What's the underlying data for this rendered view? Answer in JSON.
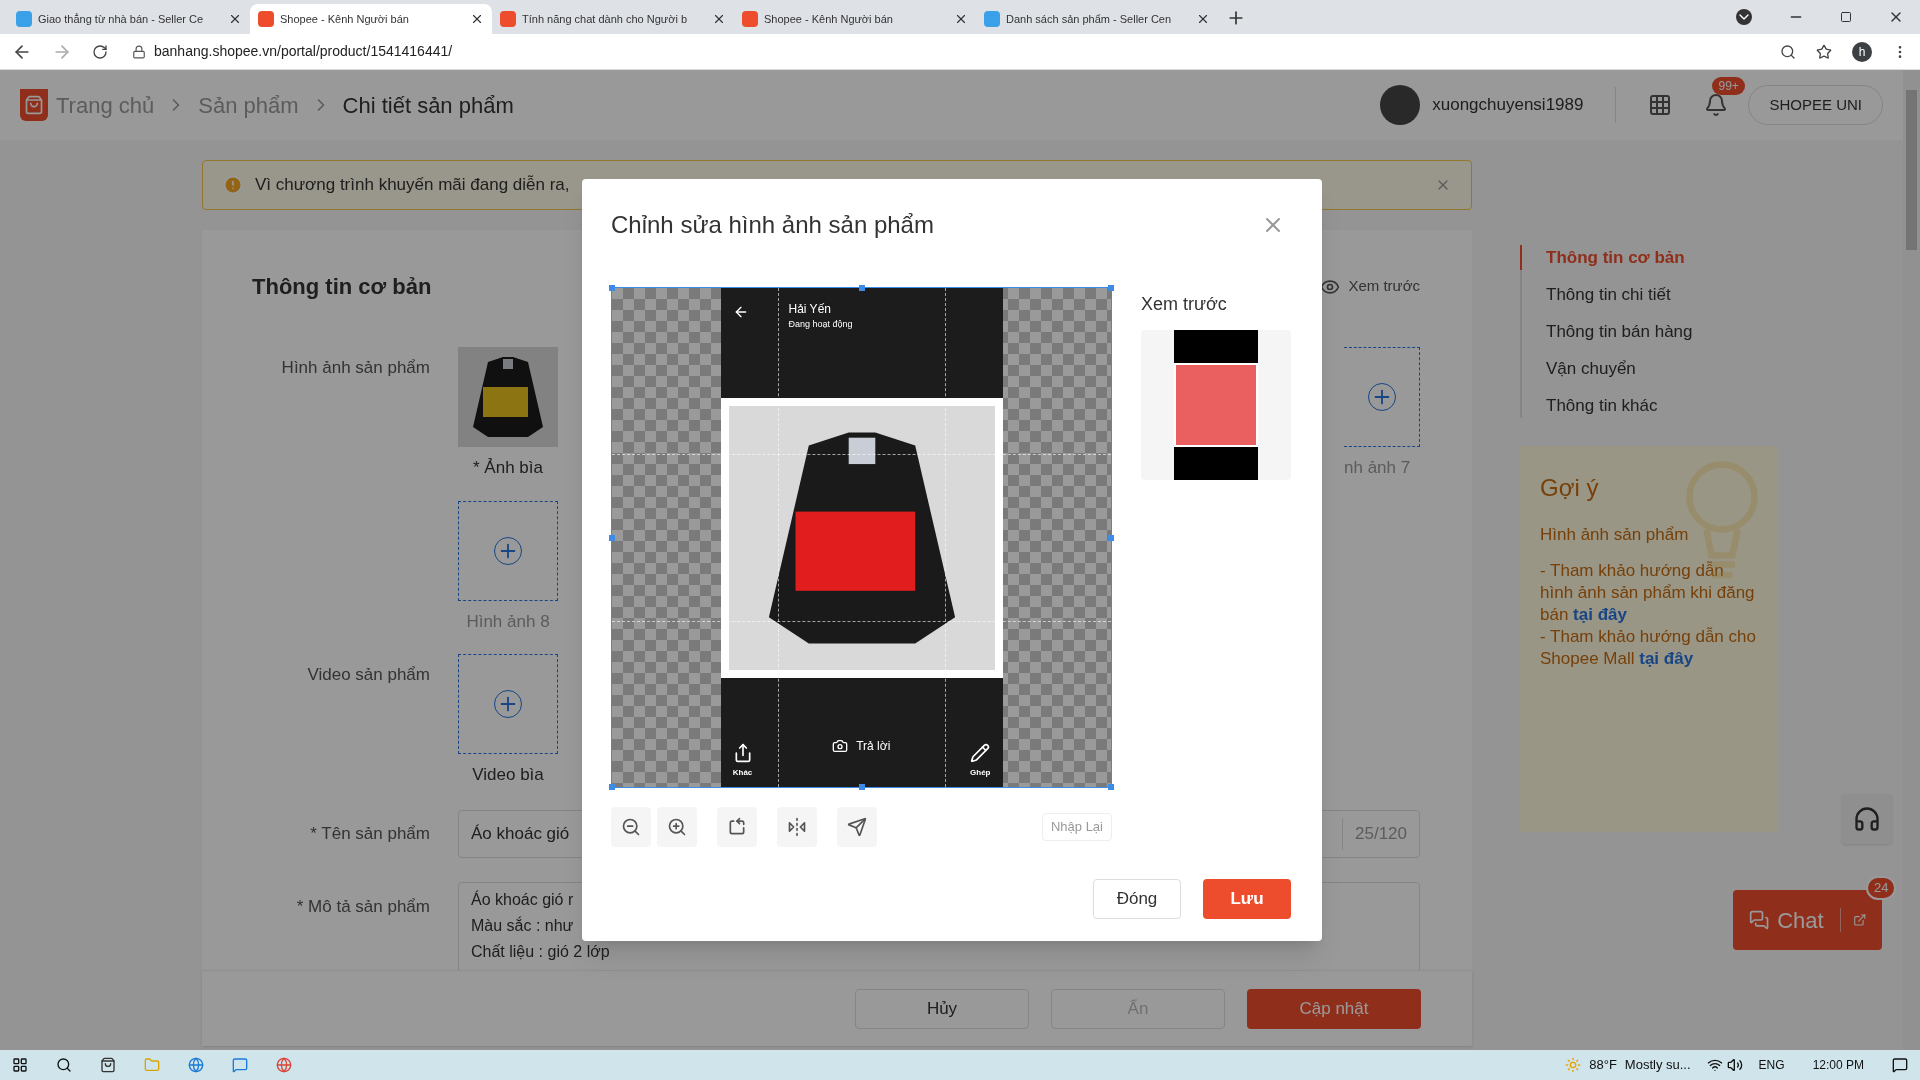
{
  "browser": {
    "tabs": [
      {
        "kind": "seller",
        "title": "Giao thẳng từ nhà bán - Seller Ce",
        "selected": false
      },
      {
        "kind": "shopee",
        "title": "Shopee - Kênh Người bán",
        "selected": true
      },
      {
        "kind": "shopee",
        "title": "Tính năng chat dành cho Người b",
        "selected": false
      },
      {
        "kind": "shopee",
        "title": "Shopee - Kênh Người bán",
        "selected": false
      },
      {
        "kind": "seller",
        "title": "Danh sách sản phẩm - Seller Cen",
        "selected": false
      }
    ],
    "address": "banhang.shopee.vn/portal/product/1541416441/",
    "profile": "h"
  },
  "header": {
    "breadcrumbs": [
      "Trang chủ",
      "Sản phẩm",
      "Chi tiết sản phẩm"
    ],
    "username": "xuongchuyensi1989",
    "notifications": "99+",
    "button": "SHOPEE UNI"
  },
  "banner": {
    "text": "Vì chương trình khuyến mãi đang diễn ra,"
  },
  "form": {
    "title": "Thông tin cơ bản",
    "preview": "Xem trước",
    "images_label": "Hình ảnh sản phẩm",
    "image_slots": [
      {
        "kind": "image",
        "label": "* Ảnh bìa"
      },
      {
        "kind": "add",
        "label": "Hình ảnh 8"
      }
    ],
    "side_slot": {
      "label": "nh ảnh 7"
    },
    "video_label": "Video sản phẩm",
    "video_slot": {
      "kind": "add",
      "label": "Video bìa"
    },
    "name_label": "* Tên sản phẩm",
    "name_value": "Áo khoác gió",
    "name_count": "25/120",
    "desc_label": "* Mô tả sản phẩm",
    "desc_lines": [
      "Áo khoác gió r",
      "Màu sắc : như",
      "Chất liệu : gió 2 lớp"
    ],
    "actions": [
      {
        "label": "Hủy",
        "kind": "default",
        "disabled": false
      },
      {
        "label": "Ẩn",
        "kind": "default",
        "disabled": true
      },
      {
        "label": "Cập nhật",
        "kind": "primary",
        "disabled": false
      }
    ]
  },
  "nav": [
    {
      "label": "Thông tin cơ bản",
      "selected": true
    },
    {
      "label": "Thông tin chi tiết",
      "selected": false
    },
    {
      "label": "Thông tin bán hàng",
      "selected": false
    },
    {
      "label": "Vận chuyển",
      "selected": false
    },
    {
      "label": "Thông tin khác",
      "selected": false
    }
  ],
  "tips": {
    "title": "Gợi ý",
    "subtitle": "Hình ảnh sản phẩm",
    "items": [
      {
        "text": "- Tham khảo hướng dẫn hình ảnh sản phẩm khi đăng bán",
        "link": "tại đây"
      },
      {
        "text": "- Tham khảo hướng dẫn cho Shopee Mall",
        "link": "tại đây"
      }
    ]
  },
  "chat": {
    "label": "Chat",
    "badge": "24"
  },
  "modal": {
    "title": "Chỉnh sửa hình ảnh sản phẩm",
    "preview_label": "Xem trước",
    "screenshot": {
      "name": "Hải Yến",
      "status": "Đang hoạt động",
      "actions": [
        {
          "kind": "share",
          "label": "Khác"
        },
        {
          "kind": "camera",
          "label": "Trả lời"
        },
        {
          "kind": "pencil",
          "label": "Ghép"
        }
      ]
    },
    "tools": [
      {
        "kind": "zoom-out"
      },
      {
        "kind": "zoom-in"
      },
      {
        "kind": "rotate"
      },
      {
        "kind": "flip"
      },
      {
        "kind": "send"
      }
    ],
    "reset": "Nhập Lại",
    "buttons": [
      {
        "label": "Đóng",
        "kind": "default"
      },
      {
        "label": "Lưu",
        "kind": "primary"
      }
    ]
  },
  "taskbar": {
    "temperature": "88°F",
    "weather": "Mostly su...",
    "language": "ENG",
    "time": "12:00 PM"
  }
}
